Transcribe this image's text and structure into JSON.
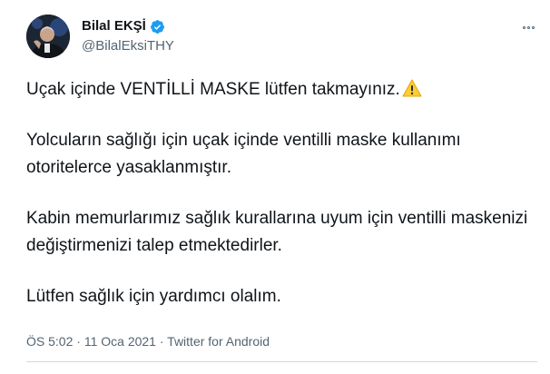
{
  "author": {
    "display_name": "Bilal EKŞİ",
    "handle": "@BilalEksiTHY"
  },
  "icons": {
    "verified": "verified-badge-icon",
    "more": "more-options-icon",
    "warning": "warning-emoji-icon"
  },
  "tweet": {
    "line1": "Uçak içinde VENTİLLİ MASKE lütfen takmayınız.",
    "para2": "Yolcuların sağlığı için uçak içinde ventilli maske kullanımı  otoritelerce yasaklanmıştır.",
    "para3": "Kabin memurlarımız sağlık kurallarına uyum için ventilli maskenizi değiştirmenizi talep etmektedirler.",
    "para4": "Lütfen sağlık için yardımcı olalım."
  },
  "meta": {
    "time": "ÖS 5:02",
    "separator1": " · ",
    "date": "11 Oca 2021",
    "separator2": " · ",
    "source": "Twitter for Android"
  },
  "colors": {
    "verified": "#1d9bf0",
    "warning": "#ffcc33",
    "secondary_text": "#536471"
  }
}
